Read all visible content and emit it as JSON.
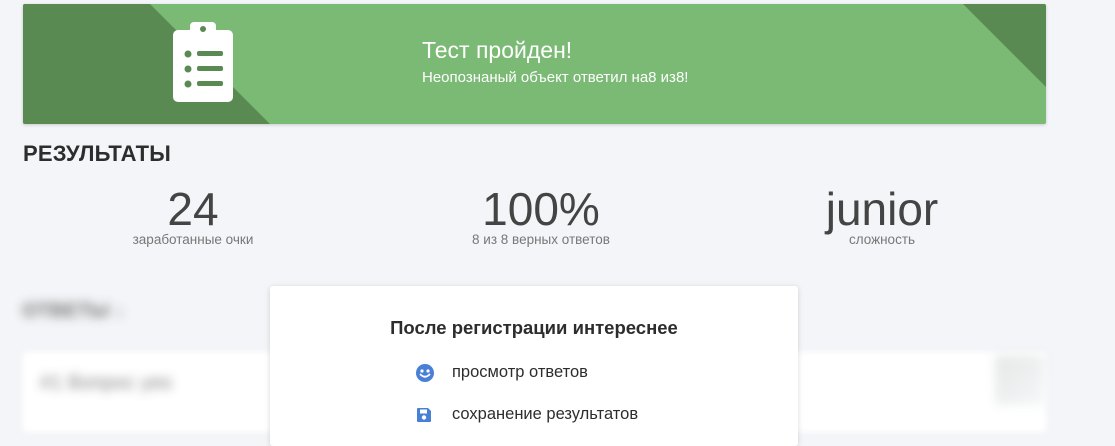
{
  "banner": {
    "title": "Тест пройден!",
    "subtitle": "Неопознаный объект ответил на8 из8!",
    "icon": "clipboard-list-icon",
    "colors": {
      "light": "#7aba74",
      "dark": "#588a52"
    }
  },
  "results": {
    "heading": "РЕЗУЛЬТАТЫ",
    "stats": [
      {
        "value": "24",
        "label": "заработанные очки"
      },
      {
        "value": "100%",
        "label": "8 из 8 верных ответов"
      },
      {
        "value": "junior",
        "label": "сложность"
      }
    ]
  },
  "answers": {
    "heading": "ОТВЕТЫ ↓",
    "first_item": "#1 Вопрос yes"
  },
  "modal": {
    "title": "После регистрации интереснее",
    "features": [
      {
        "icon": "smile-icon",
        "label": "просмотр ответов"
      },
      {
        "icon": "floppy-disk-icon",
        "label": "сохранение результатов"
      }
    ],
    "icon_color": "#4a7fd6"
  }
}
